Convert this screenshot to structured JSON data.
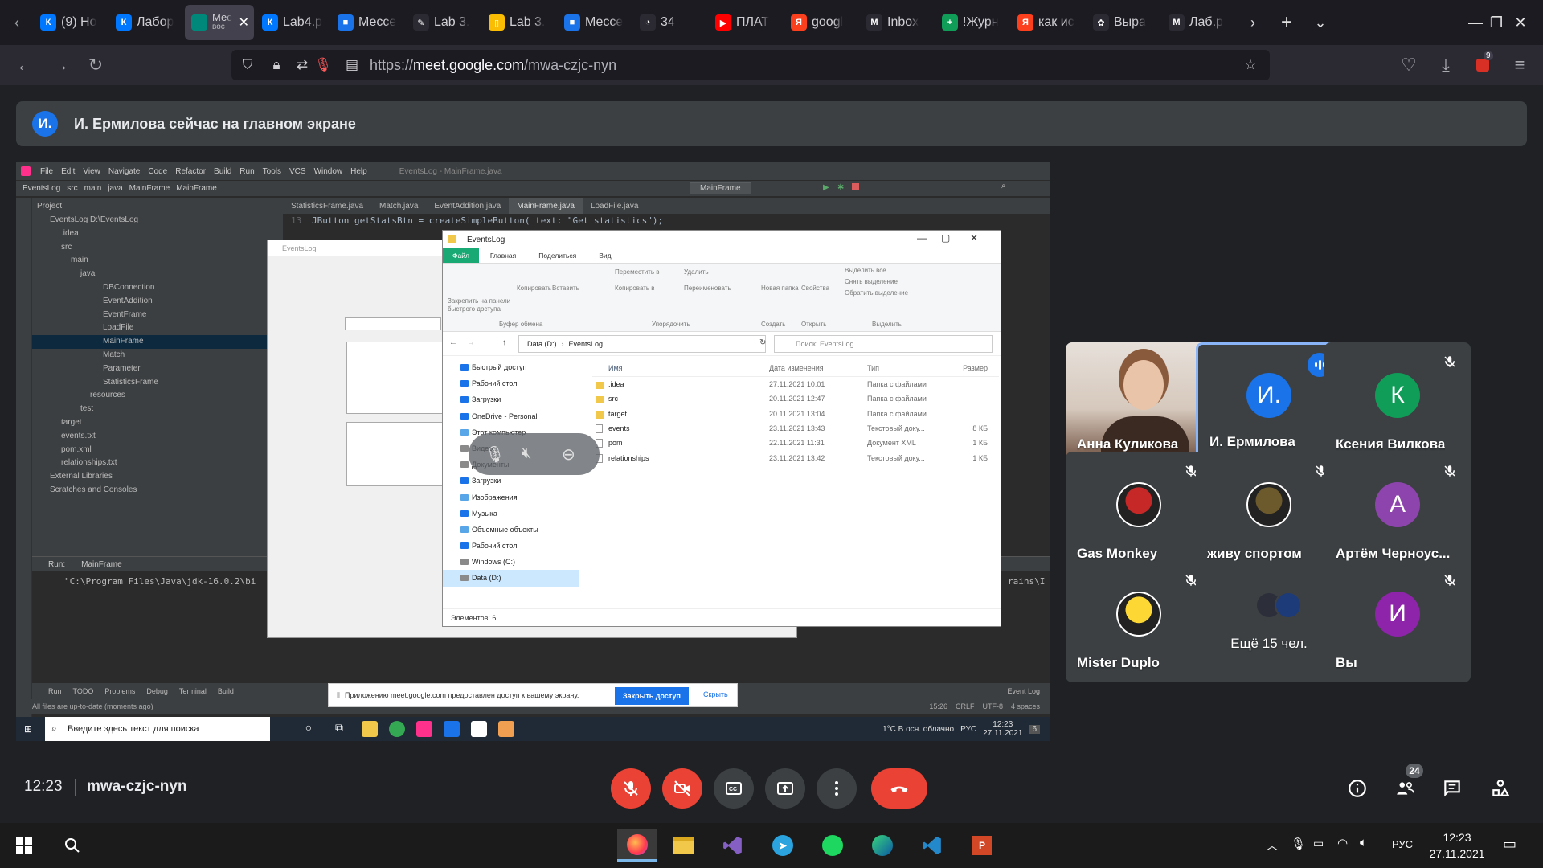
{
  "browser": {
    "tabs": [
      {
        "label": "(9) Но",
        "icon": "vk-icon",
        "color": "#0077ff",
        "glyph": "К"
      },
      {
        "label": "Лабор",
        "icon": "vk-icon",
        "color": "#0077ff",
        "glyph": "К"
      },
      {
        "label": "Мес",
        "icon": "meet-icon",
        "color": "#00897b",
        "glyph": "",
        "active": true,
        "sub": "вос"
      },
      {
        "label": "Lab4.p",
        "icon": "vk-icon",
        "color": "#0077ff",
        "glyph": "К"
      },
      {
        "label": "Мессе",
        "icon": "messenger-icon",
        "color": "#1a73e8",
        "glyph": "■"
      },
      {
        "label": "Lab 3.",
        "icon": "feather-icon",
        "color": "#2b2a33",
        "glyph": "✎"
      },
      {
        "label": "Lab 3.",
        "icon": "doc-icon",
        "color": "#fbbc04",
        "glyph": "▯"
      },
      {
        "label": "Мессе",
        "icon": "messenger-icon",
        "color": "#1a73e8",
        "glyph": "■"
      },
      {
        "label": "34",
        "icon": "gauge-icon",
        "color": "#2b2a33",
        "glyph": "◔"
      },
      {
        "label": "ПЛАТ",
        "icon": "youtube-icon",
        "color": "#ff0000",
        "glyph": "▶"
      },
      {
        "label": "googl",
        "icon": "yandex-icon",
        "color": "#fc3f1d",
        "glyph": "Я"
      },
      {
        "label": "Inbox",
        "icon": "gmail-icon",
        "color": "#2b2a33",
        "glyph": "M"
      },
      {
        "label": "!Журн",
        "icon": "journal-icon",
        "color": "#0f9d58",
        "glyph": "+"
      },
      {
        "label": "как ис",
        "icon": "yandex-icon",
        "color": "#fc3f1d",
        "glyph": "Я"
      },
      {
        "label": "Выра",
        "icon": "puzzle-icon",
        "color": "#2b2a33",
        "glyph": "✿"
      },
      {
        "label": "Лаб.р",
        "icon": "gmail-icon",
        "color": "#2b2a33",
        "glyph": "M"
      }
    ],
    "url_prefix": "https://",
    "url_host": "meet.google.com",
    "url_path": "/mwa-czjc-nyn",
    "downloads_badge": "9"
  },
  "meet": {
    "banner_avatar": "И.",
    "banner_text": "И. Ермилова сейчас на главном экране",
    "time": "12:23",
    "code": "mwa-czjc-nyn",
    "participants_count": "24",
    "tiles": [
      {
        "name": "Анна Куликова",
        "type": "video",
        "muted": false
      },
      {
        "name": "И. Ермилова",
        "type": "initial",
        "initial": "И.",
        "color": "#1a73e8",
        "speaking": true
      },
      {
        "name": "Ксения Вилкова",
        "type": "initial",
        "initial": "К",
        "color": "#0f9d58",
        "muted": true
      },
      {
        "name": "Gas Monkey",
        "type": "photo",
        "color": "#c62828",
        "muted": true
      },
      {
        "name": "живу спортом",
        "type": "photo",
        "color": "#6d5a2c",
        "muted": true
      },
      {
        "name": "Артём Черноус...",
        "type": "initial",
        "initial": "А",
        "color": "#8e44ad",
        "muted": true
      },
      {
        "name": "Mister Duplo",
        "type": "photo",
        "color": "#fdd835",
        "muted": true
      },
      {
        "name": "Ещё 15 чел.",
        "type": "more"
      },
      {
        "name": "Вы",
        "type": "initial",
        "initial": "И",
        "color": "#8e24aa",
        "muted": true
      }
    ]
  },
  "shared": {
    "ide_menu": [
      "File",
      "Edit",
      "View",
      "Navigate",
      "Code",
      "Refactor",
      "Build",
      "Run",
      "Tools",
      "VCS",
      "Window",
      "Help"
    ],
    "ide_title": "EventsLog - MainFrame.java",
    "crumbs": [
      "EventsLog",
      "src",
      "main",
      "java",
      "MainFrame",
      "MainFrame"
    ],
    "run_config": "MainFrame",
    "editor_tabs": [
      "StatisticsFrame.java",
      "Match.java",
      "EventAddition.java",
      "MainFrame.java",
      "LoadFile.java"
    ],
    "project_label": "Project",
    "tree": [
      "EventsLog  D:\\EventsLog",
      ".idea",
      "src",
      "main",
      "java",
      "DBConnection",
      "EventAddition",
      "EventFrame",
      "LoadFile",
      "MainFrame",
      "Match",
      "Parameter",
      "StatisticsFrame",
      "resources",
      "test",
      "target",
      "events.txt",
      "pom.xml",
      "relationships.txt",
      "External Libraries",
      "Scratches and Consoles"
    ],
    "code_line_no": "13",
    "code_line": "JButton getStatsBtn = createSimpleButton( text: \"Get statistics\");",
    "run_label": "Run:",
    "run_tab": "MainFrame",
    "run_path": "\"C:\\Program Files\\Java\\jdk-16.0.2\\bi",
    "run_path_tail": "rains\\I",
    "bottom_tabs": [
      "Run",
      "TODO",
      "Problems",
      "Debug",
      "Terminal",
      "Build"
    ],
    "event_log": "Event Log",
    "status_left": "All files are up-to-date (moments ago)",
    "status_right": [
      "15:26",
      "CRLF",
      "UTF-8",
      "4 spaces"
    ],
    "app_title": "EventsLog",
    "explorer": {
      "title": "EventsLog",
      "ribbon_tabs": [
        "Файл",
        "Главная",
        "Поделиться",
        "Вид"
      ],
      "ribbon_groups": [
        "Буфер обмена",
        "Упорядочить",
        "Создать",
        "Открыть",
        "Выделить"
      ],
      "ribbon_items": [
        "Закрепить на панели быстрого доступа",
        "Копировать",
        "Вставить",
        "Переместить в",
        "Копировать в",
        "Удалить",
        "Переименовать",
        "Новая папка",
        "Свойства",
        "Выделить все",
        "Снять выделение",
        "Обратить выделение"
      ],
      "path": [
        "Data (D:)",
        "EventsLog"
      ],
      "search_placeholder": "Поиск: EventsLog",
      "nav": [
        "Быстрый доступ",
        "Рабочий стол",
        "Загрузки",
        "OneDrive - Personal",
        "Этот компьютер",
        "Видео",
        "Документы",
        "Загрузки",
        "Изображения",
        "Музыка",
        "Объемные объекты",
        "Рабочий стол",
        "Windows (C:)",
        "Data (D:)"
      ],
      "columns": [
        "Имя",
        "Дата изменения",
        "Тип",
        "Размер"
      ],
      "files": [
        {
          "name": ".idea",
          "date": "27.11.2021 10:01",
          "type": "Папка с файлами",
          "size": "",
          "kind": "folder"
        },
        {
          "name": "src",
          "date": "20.11.2021 12:47",
          "type": "Папка с файлами",
          "size": "",
          "kind": "folder"
        },
        {
          "name": "target",
          "date": "20.11.2021 13:04",
          "type": "Папка с файлами",
          "size": "",
          "kind": "folder"
        },
        {
          "name": "events",
          "date": "23.11.2021 13:43",
          "type": "Текстовый доку...",
          "size": "8 КБ",
          "kind": "doc"
        },
        {
          "name": "pom",
          "date": "22.11.2021 11:31",
          "type": "Документ XML",
          "size": "1 КБ",
          "kind": "doc"
        },
        {
          "name": "relationships",
          "date": "23.11.2021 13:42",
          "type": "Текстовый доку...",
          "size": "1 КБ",
          "kind": "doc"
        }
      ],
      "status": "Элементов: 6"
    },
    "share_notice": "Приложению meet.google.com предоставлен доступ к вашему экрану.",
    "share_stop": "Закрыть доступ",
    "share_hide": "Скрыть",
    "win_search": "Введите здесь текст для поиска",
    "win_weather": "1°C  В осн. облачно",
    "win_lang": "РУС",
    "win_time": "12:23",
    "win_date": "27.11.2021",
    "win_notif": "6"
  },
  "taskbar": {
    "lang": "РУС",
    "time": "12:23",
    "date": "27.11.2021"
  }
}
